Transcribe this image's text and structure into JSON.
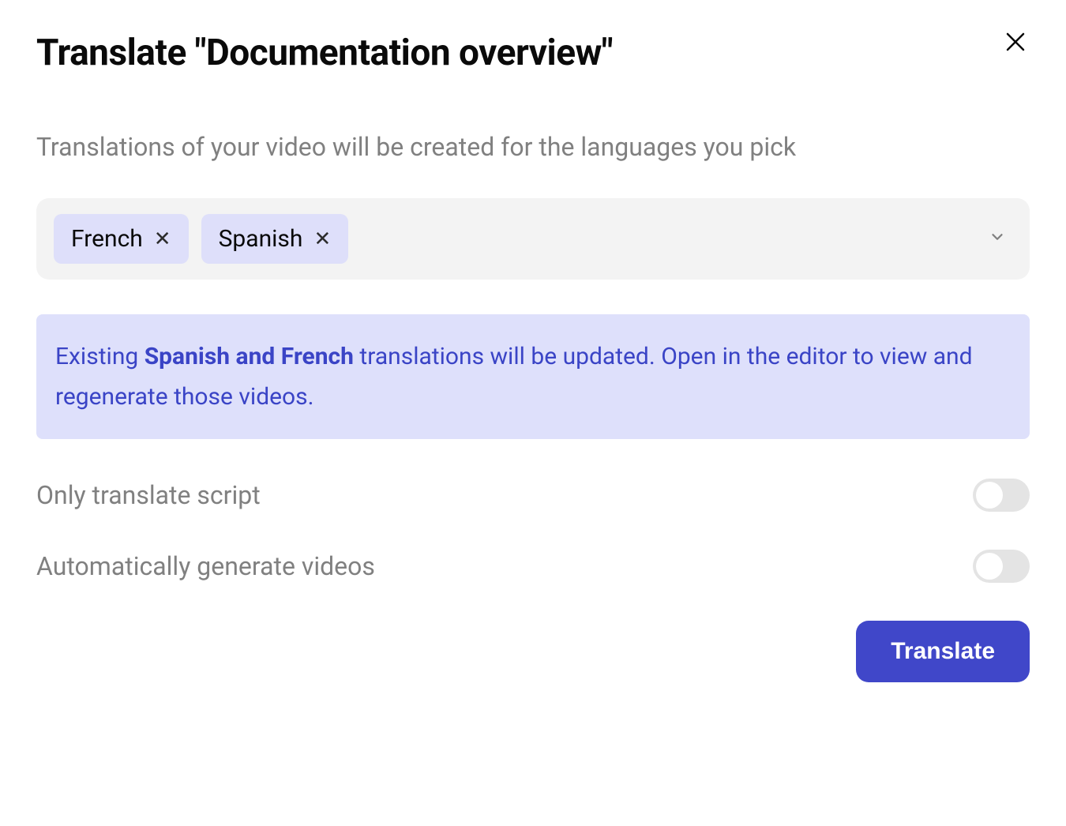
{
  "dialog": {
    "title": "Translate \"Documentation overview\"",
    "subtitle": "Translations of your video will be created for the languages you pick",
    "translate_button": "Translate"
  },
  "language_chips": [
    {
      "label": "French"
    },
    {
      "label": "Spanish"
    }
  ],
  "info_banner": {
    "prefix": "Existing ",
    "bold": "Spanish and French",
    "suffix": " translations will be updated. Open in the editor to view and regenerate those videos."
  },
  "toggles": {
    "only_script": {
      "label": "Only translate script",
      "on": false
    },
    "auto_generate": {
      "label": "Automatically generate videos",
      "on": false
    }
  }
}
